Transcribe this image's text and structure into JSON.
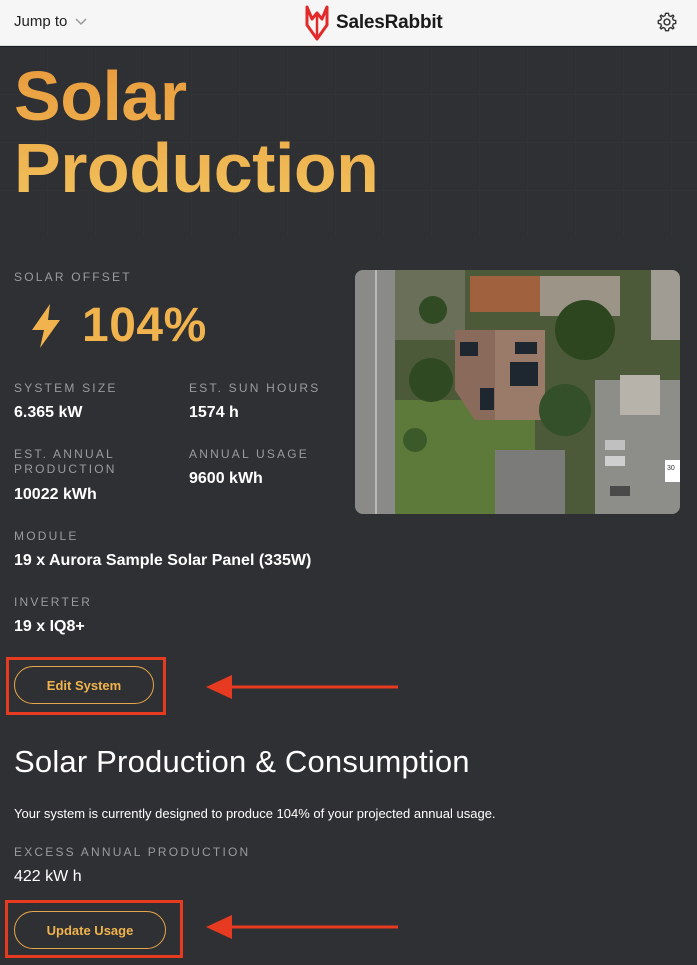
{
  "header": {
    "jump_label": "Jump to",
    "brand_name": "SalesRabbit",
    "brand_color": "#e32a2a"
  },
  "hero": {
    "title_line1": "Solar",
    "title_line2": "Production",
    "offset_label": "SOLAR OFFSET",
    "offset_value": "104%",
    "accent_color": "#f0b34e"
  },
  "stats": {
    "system_size_label": "SYSTEM SIZE",
    "system_size_value": "6.365 kW",
    "sun_hours_label": "EST. SUN HOURS",
    "sun_hours_value": "1574 h",
    "annual_prod_label_1": "EST. ANNUAL",
    "annual_prod_label_2": "PRODUCTION",
    "annual_prod_value": "10022 kWh",
    "annual_usage_label": "ANNUAL USAGE",
    "annual_usage_value": "9600 kWh",
    "module_label": "MODULE",
    "module_value": "19 x Aurora Sample Solar Panel (335W)",
    "inverter_label": "INVERTER",
    "inverter_value": "19 x IQ8+"
  },
  "buttons": {
    "edit_system": "Edit System",
    "update_usage": "Update Usage"
  },
  "consumption": {
    "title": "Solar Production & Consumption",
    "description": "Your system is currently designed to produce 104% of your projected annual usage.",
    "excess_label": "EXCESS ANNUAL PRODUCTION",
    "excess_value": "422 kW h"
  },
  "map": {
    "scale_label": "30"
  },
  "icons": {
    "dropdown": "chevron-down-icon",
    "settings": "gear-icon",
    "offset": "lightning-bolt-icon"
  },
  "annotation_color": "#e63a21"
}
